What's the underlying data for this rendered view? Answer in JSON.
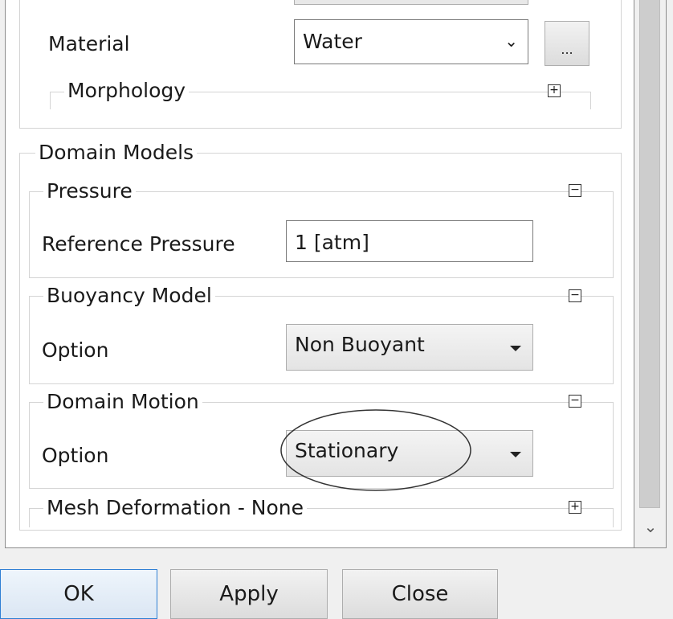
{
  "material": {
    "label": "Material",
    "value": "Water",
    "browse_label": "..."
  },
  "morphology": {
    "title": "Morphology"
  },
  "domain_models": {
    "title": "Domain Models",
    "pressure": {
      "title": "Pressure",
      "reference_label": "Reference Pressure",
      "reference_value": "1 [atm]"
    },
    "buoyancy": {
      "title": "Buoyancy Model",
      "option_label": "Option",
      "option_value": "Non Buoyant"
    },
    "domain_motion": {
      "title": "Domain Motion",
      "option_label": "Option",
      "option_value": "Stationary"
    },
    "mesh_deformation": {
      "title": "Mesh Deformation - None"
    }
  },
  "buttons": {
    "ok": "OK",
    "apply": "Apply",
    "close": "Close"
  },
  "icons": {
    "expand": "plus-box-icon",
    "collapse": "minus-box-icon",
    "dropdown": "chevron-down-icon"
  },
  "colors": {
    "default_button_border": "#2f7fd4",
    "annotation_ellipse": "#333333"
  }
}
